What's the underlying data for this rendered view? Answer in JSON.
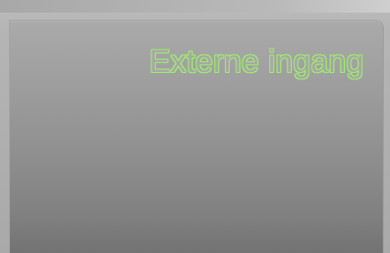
{
  "panel": {
    "title": "Externe ingang"
  },
  "colors": {
    "title_outline": "#9df06a",
    "panel_top": "#aaaaaa",
    "panel_bottom": "#777777",
    "background": "#b5b5b5"
  }
}
